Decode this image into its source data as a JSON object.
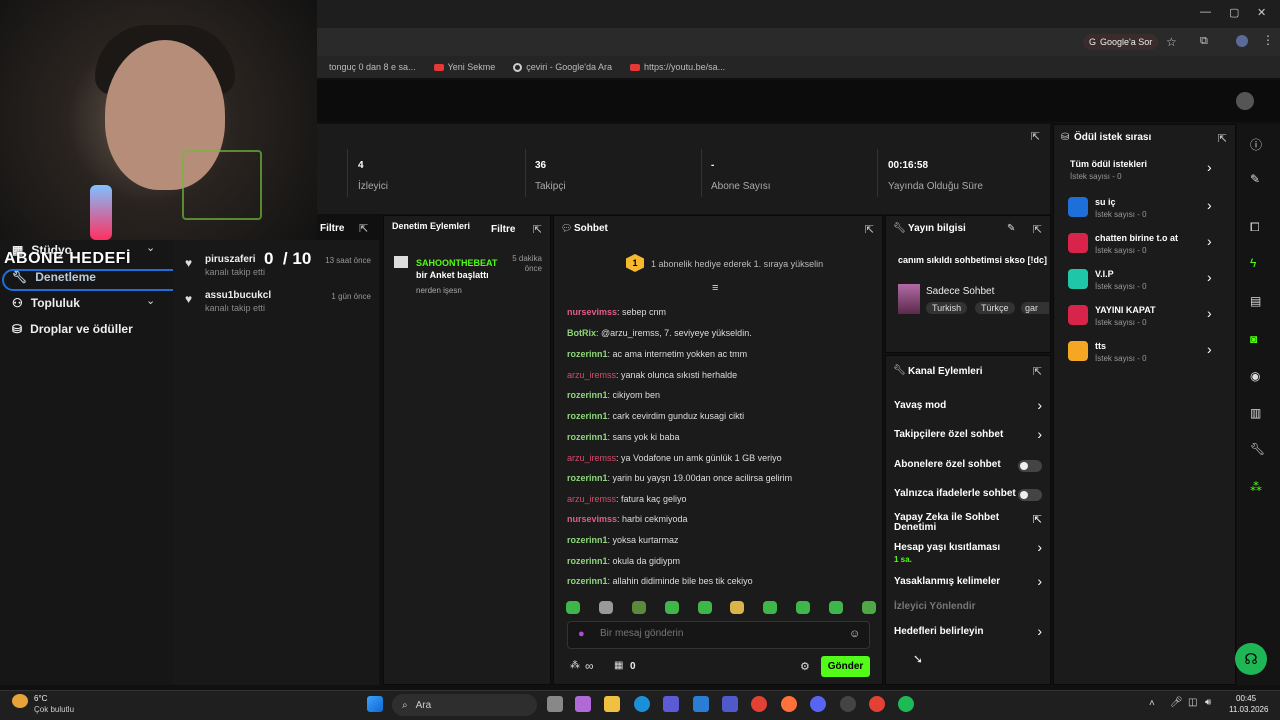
{
  "browser": {
    "bookmarks": [
      {
        "label": "tonguç 0 dan 8 e sa...",
        "icon": "youtube-icon"
      },
      {
        "label": "Yeni Sekme",
        "icon": "youtube-icon"
      },
      {
        "label": "çeviri - Google'da Ara",
        "icon": "google-icon"
      },
      {
        "label": "https://youtu.be/sa...",
        "icon": "youtube-icon"
      }
    ],
    "ask_google": "Google'a Sor",
    "window_controls": [
      "—",
      "▢",
      "✕"
    ]
  },
  "overlay": {
    "goal_title": "ABONE HEDEFİ",
    "goal_current": "0",
    "goal_target": "/ 10"
  },
  "sidebar": {
    "items": [
      {
        "label": "Stüdyo",
        "icon": "studio-icon"
      },
      {
        "label": "Denetleme",
        "icon": "wrench-icon"
      },
      {
        "label": "Topluluk",
        "icon": "community-icon"
      },
      {
        "label": "Droplar ve ödüller",
        "icon": "drops-icon"
      }
    ]
  },
  "followers": [
    {
      "name": "piruszaferi",
      "sub": "kanalı takip etti",
      "time": "13 saat önce"
    },
    {
      "name": "assu1bucukcl",
      "sub": "kanalı takip etti",
      "time": "1 gün önce"
    }
  ],
  "stats": [
    {
      "value": "4",
      "label": "İzleyici"
    },
    {
      "value": "36",
      "label": "Takipçi"
    },
    {
      "value": "-",
      "label": "Abone Sayısı"
    },
    {
      "value": "00:16:58",
      "label": "Yayında Olduğu Süre"
    }
  ],
  "filter_label": "Filtre",
  "mod_actions": {
    "title": "Denetim Eylemleri",
    "filter": "Filtre",
    "entry": {
      "user": "SAHOONTHEBEAT",
      "action": "bir Anket başlattı",
      "detail": "nerden işesn",
      "time": "5 dakika önce"
    }
  },
  "chat": {
    "title": "Sohbet",
    "gift_banner": "1 abonelik hediye ederek 1. sıraya yükselin",
    "gift_rank": "1",
    "messages": [
      {
        "user": "nursevimss",
        "color": "p",
        "text": ": sebep cnm"
      },
      {
        "user": "BotRix",
        "color": "g",
        "text": ": @arzu_iremss, 7. seviyeye yükseldin."
      },
      {
        "user": "rozerinn1",
        "color": "g",
        "text": ": ac ama internetim yokken ac tmm"
      },
      {
        "user": "arzu_iremss",
        "color": "r",
        "text": ": yanak olunca sıkısti herhalde"
      },
      {
        "user": "rozerinn1",
        "color": "g",
        "text": ": cikiyom ben"
      },
      {
        "user": "rozerinn1",
        "color": "g",
        "text": ": cark cevirdim gunduz kusagi cikti"
      },
      {
        "user": "rozerinn1",
        "color": "g",
        "text": ": sans yok ki baba"
      },
      {
        "user": "arzu_iremss",
        "color": "r",
        "text": ": ya Vodafone un amk günlük 1 GB veriyo"
      },
      {
        "user": "rozerinn1",
        "color": "g",
        "text": ": yarin bu yayşn 19.00dan once acilirsa gelirim"
      },
      {
        "user": "arzu_iremss",
        "color": "r",
        "text": ": fatura kaç geliyo"
      },
      {
        "user": "nursevimss",
        "color": "p",
        "text": ": harbi cekmiyoda"
      },
      {
        "user": "rozerinn1",
        "color": "g",
        "text": ": yoksa kurtarmaz"
      },
      {
        "user": "rozerinn1",
        "color": "g",
        "text": ": okula da gidiypm"
      },
      {
        "user": "rozerinn1",
        "color": "g",
        "text": ": allahin didiminde bile bes tik cekiyo"
      }
    ],
    "placeholder": "Bir mesaj gönderin",
    "points": "∞",
    "count": "0",
    "send": "Gönder"
  },
  "stream_info": {
    "title": "Yayın bilgisi",
    "stream_title": "canım sıkıldı sohbetimsi skso [!dc]",
    "category": "Sadece Sohbet",
    "tags": [
      "Turkish",
      "Türkçe",
      "gar"
    ]
  },
  "channel_actions": {
    "title": "Kanal Eylemleri",
    "rows": [
      {
        "label": "Yavaş mod",
        "control": "chevron"
      },
      {
        "label": "Takipçilere özel sohbet",
        "control": "chevron"
      },
      {
        "label": "Abonelere özel sohbet",
        "control": "toggle"
      },
      {
        "label": "Yalnızca ifadelerle sohbet",
        "control": "toggle"
      },
      {
        "label": "Yapay Zeka ile Sohbet Denetimi",
        "control": "external"
      },
      {
        "label": "Hesap yaşı kısıtlaması",
        "control": "chevron",
        "sub": "1 sa."
      },
      {
        "label": "Yasaklanmış kelimeler",
        "control": "chevron"
      },
      {
        "label": "İzleyici Yönlendir",
        "control": "none"
      },
      {
        "label": "Hedefleri belirleyin",
        "control": "chevron"
      }
    ]
  },
  "rewards": {
    "title": "Ödül istek sırası",
    "items": [
      {
        "name": "Tüm ödül istekleri",
        "sub": "İstek sayısı - 0",
        "color": ""
      },
      {
        "name": "su iç",
        "sub": "İstek sayısı - 0",
        "color": "#1e6fd9"
      },
      {
        "name": "chatten birine t.o at",
        "sub": "İstek sayısı - 0",
        "color": "#d8244a"
      },
      {
        "name": "V.I.P",
        "sub": "İstek sayısı - 0",
        "color": "#1fc7a8"
      },
      {
        "name": "YAYINI KAPAT",
        "sub": "İstek sayısı - 0",
        "color": "#d8244a"
      },
      {
        "name": "tts",
        "sub": "İstek sayısı - 0",
        "color": "#f5a623"
      }
    ]
  },
  "taskbar": {
    "weather_temp": "6°C",
    "weather_desc": "Çok bulutlu",
    "search": "Ara",
    "time": "00:45",
    "date": "11.03.2026"
  },
  "colors": {
    "accent": "#53fc18",
    "focus_ring": "#1e6fd9"
  }
}
